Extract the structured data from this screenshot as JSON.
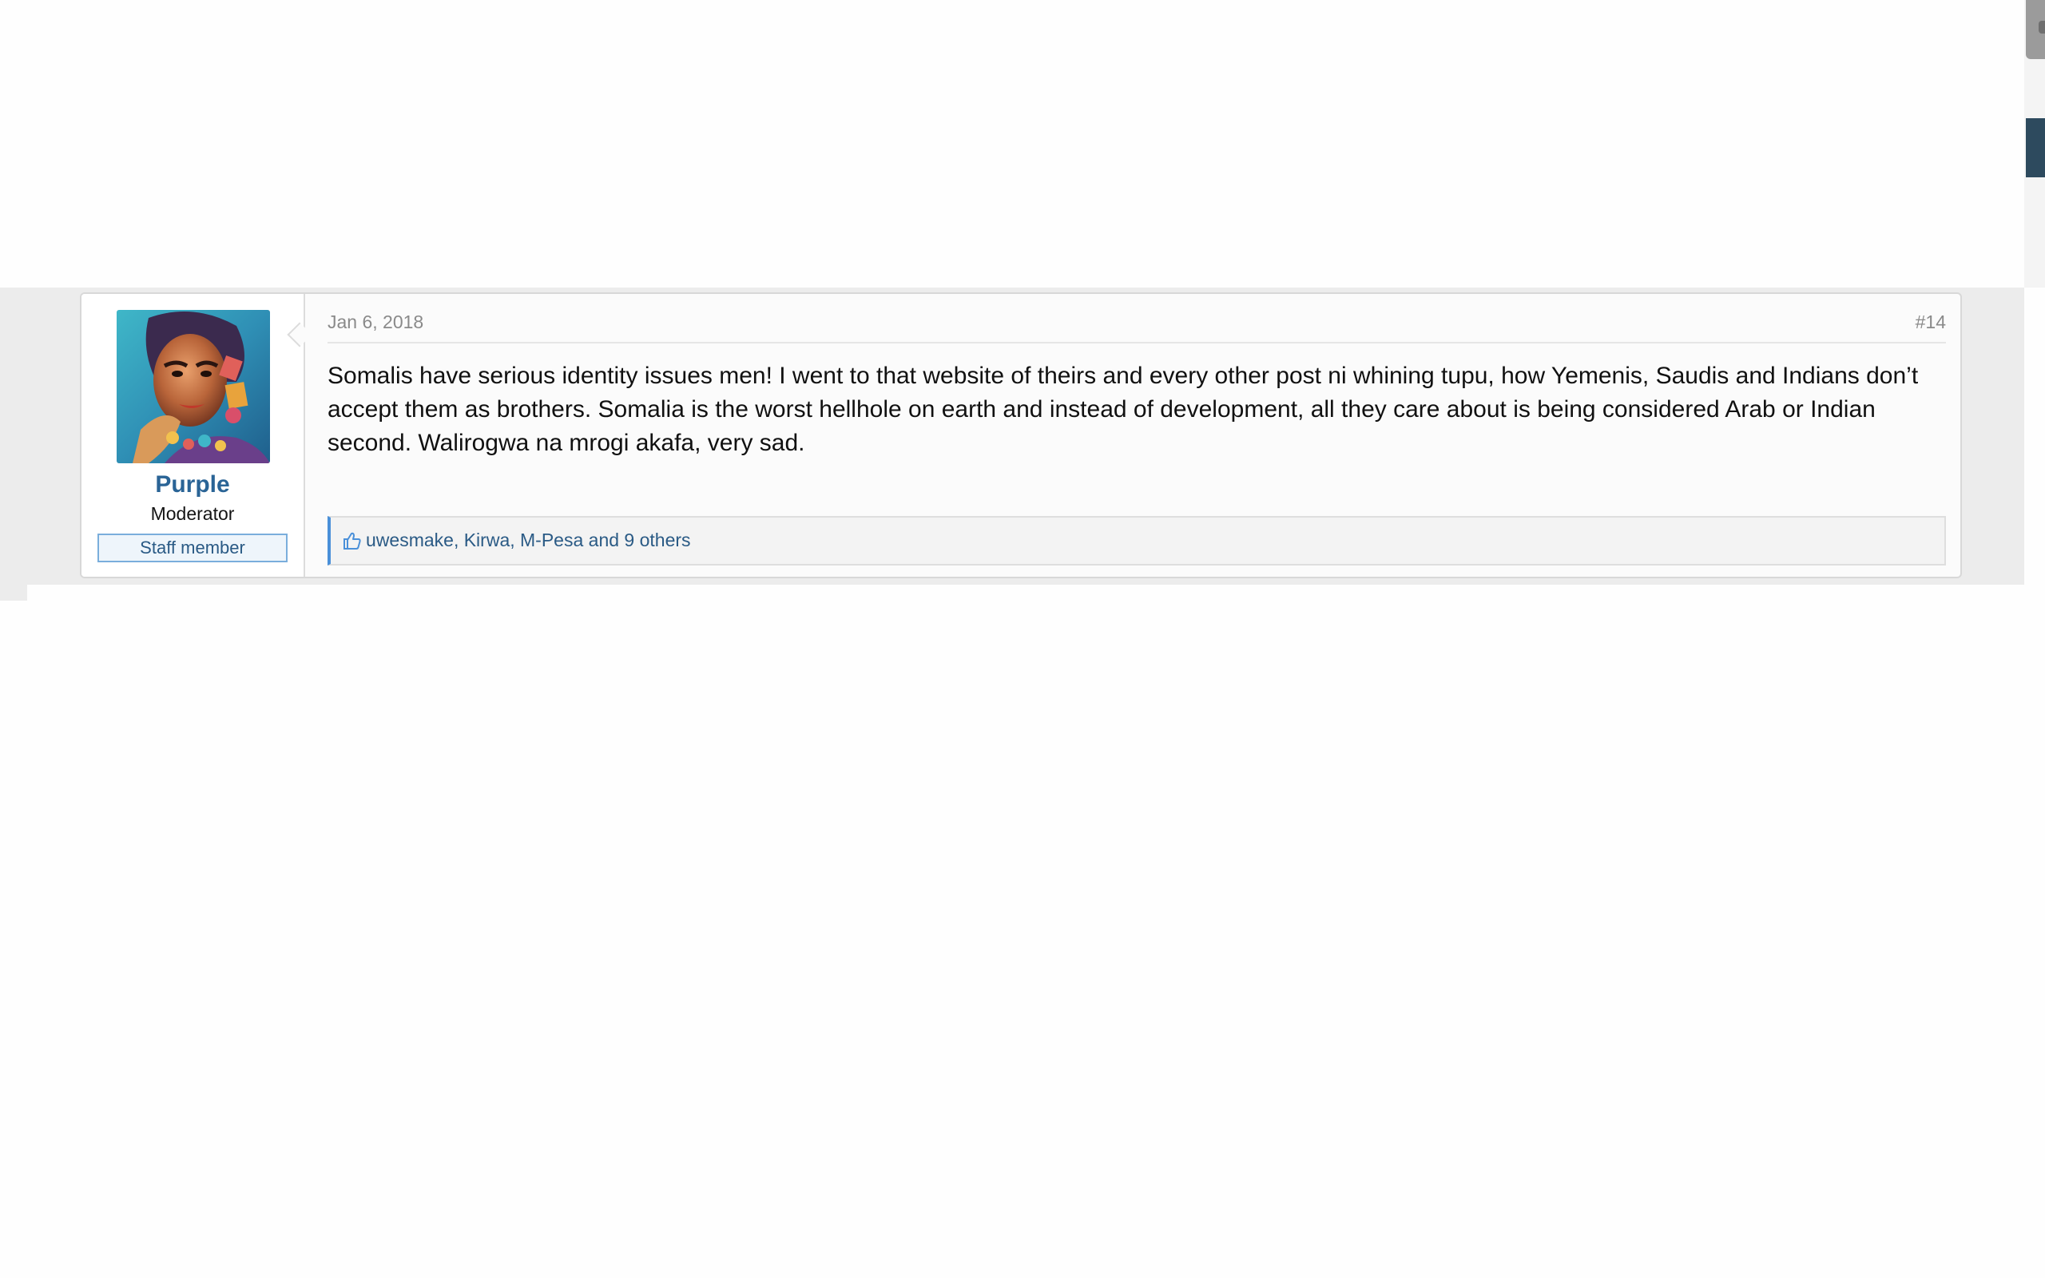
{
  "post": {
    "user": {
      "name": "Purple",
      "title": "Moderator",
      "badge": "Staff member",
      "avatar_icon": "avatar-portrait-painting"
    },
    "date": "Jan 6, 2018",
    "number": "#14",
    "message": "Somalis have serious identity issues men! I went to that website of theirs and every other post ni whining tupu, how Yemenis, Saudis and Indians don’t accept them as brothers. Somalia is the worst hellhole on earth and instead of development, all they care about is being considered Arab or Indian second. Walirogwa na mrogi akafa, very sad.",
    "likes": {
      "icon": "thumbs-up-icon",
      "users": [
        "uwesmake",
        "Kirwa",
        "M-Pesa"
      ],
      "separator": ", ",
      "others": "and 9 others"
    }
  },
  "colors": {
    "username": "#2a6496",
    "link": "#2a5a85",
    "accent": "#4a90d9",
    "band": "#ececec"
  }
}
